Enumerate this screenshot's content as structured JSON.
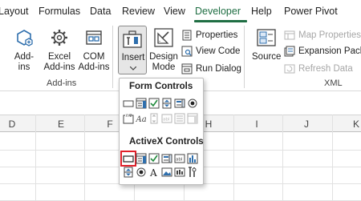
{
  "tabs": [
    {
      "label": "Layout",
      "active": false
    },
    {
      "label": "Formulas",
      "active": false
    },
    {
      "label": "Data",
      "active": false
    },
    {
      "label": "Review",
      "active": false
    },
    {
      "label": "View",
      "active": false
    },
    {
      "label": "Developer",
      "active": true
    },
    {
      "label": "Help",
      "active": false
    },
    {
      "label": "Power Pivot",
      "active": false
    }
  ],
  "addins_group": {
    "label": "Add-ins",
    "buttons": [
      {
        "line1": "Add-",
        "line2": "ins",
        "icon": "hexagon-addin-icon"
      },
      {
        "line1": "Excel",
        "line2": "Add-ins",
        "icon": "gear-icon"
      },
      {
        "line1": "COM",
        "line2": "Add-ins",
        "icon": "com-addins-icon"
      }
    ]
  },
  "controls_group": {
    "insert_label": "Insert",
    "design_line1": "Design",
    "design_line2": "Mode",
    "properties": "Properties",
    "view_code": "View Code",
    "run_dialog": "Run Dialog"
  },
  "xml_group": {
    "label": "XML",
    "source": "Source",
    "map_properties": "Map Properties",
    "expansion_packs": "Expansion Packs",
    "refresh_data": "Refresh Data"
  },
  "columns": [
    "D",
    "E",
    "F",
    "H",
    "I",
    "J",
    "K"
  ],
  "dropdown": {
    "form_controls_title": "Form Controls",
    "activex_controls_title": "ActiveX Controls",
    "form_controls": [
      "button-icon",
      "combo-box-icon",
      "check-box-icon",
      "spin-button-icon",
      "list-box-icon",
      "option-button-icon",
      "group-box-icon",
      "label-icon",
      "scroll-bar-icon",
      "text-field-icon",
      "combo-list-edit-icon",
      "combo-dropdown-edit-icon"
    ],
    "activex_controls": [
      "command-button-icon",
      "combo-box-icon",
      "check-box-icon",
      "list-box-icon",
      "text-box-icon",
      "scroll-bar-icon",
      "spin-button-icon",
      "option-button-icon",
      "label-icon",
      "image-icon",
      "toggle-button-icon",
      "more-controls-icon"
    ],
    "selected_activex_index": 0
  },
  "colors": {
    "accent_green": "#1f6e43",
    "icon_blue": "#2f6fad",
    "selection_red": "#e0202a"
  }
}
